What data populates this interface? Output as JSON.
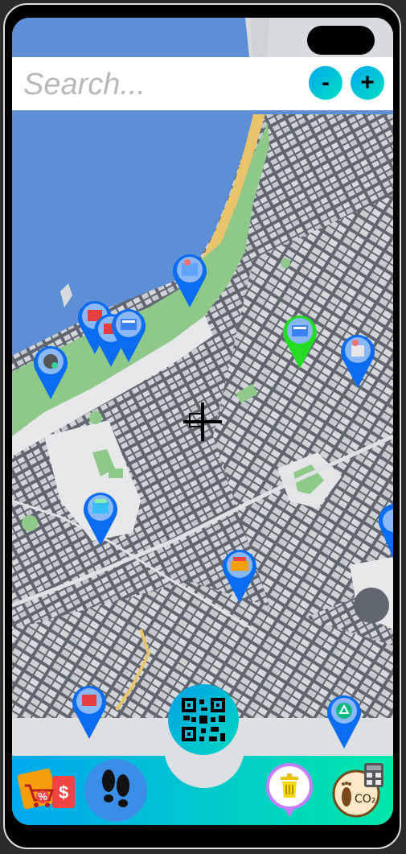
{
  "search": {
    "placeholder": "Search..."
  },
  "zoom": {
    "minus_label": "-",
    "plus_label": "+"
  },
  "map": {
    "water_color": "#5d8fd6",
    "park_color": "#8fc98a",
    "block_color": "#cfd3d6",
    "street_color": "#5f6670",
    "beach_color": "#e9c46a"
  },
  "pins": [
    {
      "name": "pin-recycling-bin",
      "color": "#0a6cf0"
    },
    {
      "name": "pin-clothes",
      "color": "#0a6cf0"
    },
    {
      "name": "pin-clothes-2",
      "color": "#0a6cf0"
    },
    {
      "name": "pin-paper",
      "color": "#0a6cf0"
    },
    {
      "name": "pin-electronics",
      "color": "#0a6cf0"
    },
    {
      "name": "pin-selected",
      "color": "#22dd22"
    },
    {
      "name": "pin-bin",
      "color": "#0a6cf0"
    },
    {
      "name": "pin-bags",
      "color": "#0a6cf0"
    },
    {
      "name": "pin-battery",
      "color": "#0a6cf0"
    },
    {
      "name": "pin-clothing",
      "color": "#0a6cf0"
    },
    {
      "name": "pin-recycle",
      "color": "#0a6cf0"
    },
    {
      "name": "pin-edge",
      "color": "#0a6cf0"
    }
  ],
  "bottom_bar": {
    "gradient_start": "#00a8f0",
    "gradient_end": "#00e8a8",
    "co2_label": "CO₂",
    "coupon_symbol": "$",
    "discount_symbol": "%"
  }
}
